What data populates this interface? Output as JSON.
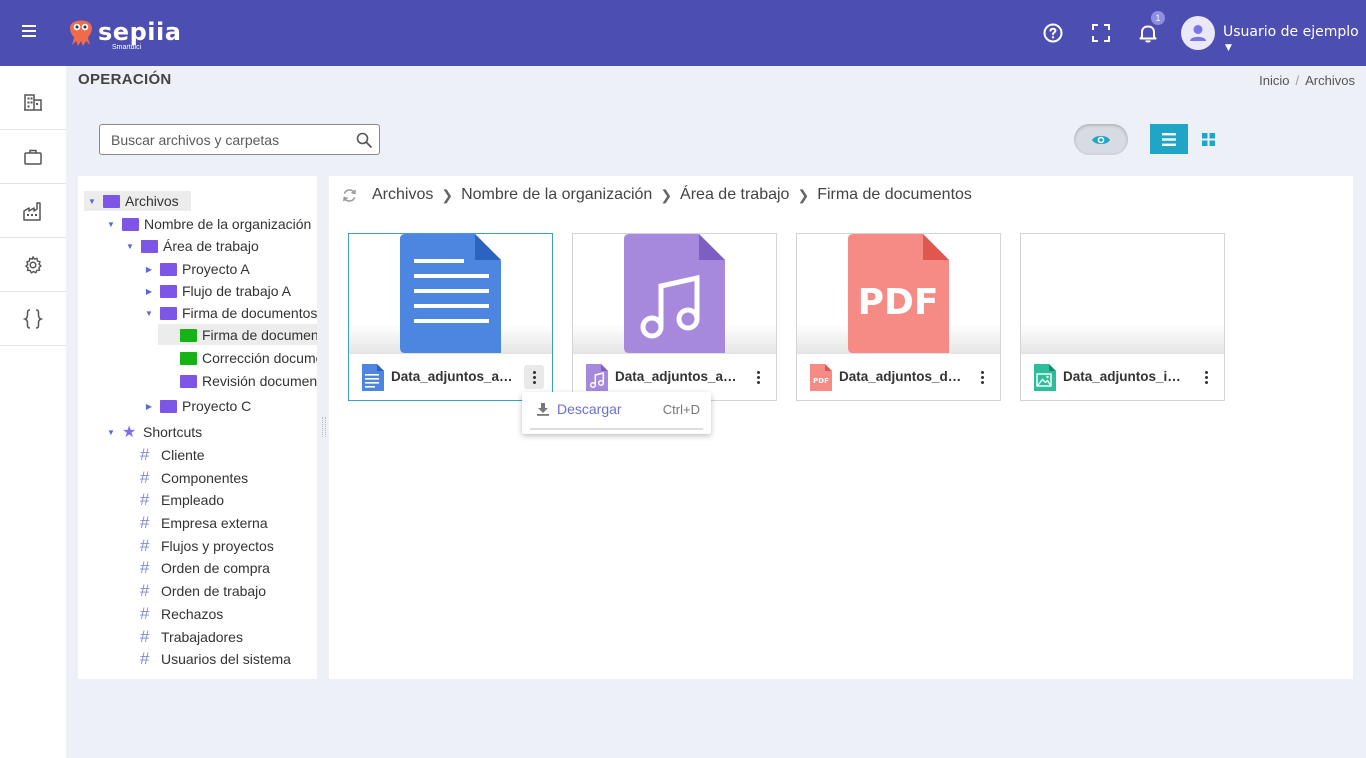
{
  "app": {
    "brand": "sepiia",
    "brand_sub": "Smartdici",
    "notifications_count": "1",
    "user_name": "Usuario de ejemplo",
    "colors": {
      "topbar": "#4d4eb1",
      "accent": "#1fa6c7",
      "folder": "#7d56e8",
      "folder_active": "#16b316"
    }
  },
  "header": {
    "title": "OPERACIÓN",
    "breadcrumb": [
      "Inicio",
      "Archivos"
    ]
  },
  "sidebar": {
    "items": [
      {
        "icon": "building-icon"
      },
      {
        "icon": "briefcase-icon"
      },
      {
        "icon": "factory-icon"
      },
      {
        "icon": "gear-icon"
      },
      {
        "icon": "braces-icon"
      }
    ]
  },
  "toolbar": {
    "search_placeholder": "Buscar archivos y carpetas",
    "view_mode": "list"
  },
  "tree": {
    "root": "Archivos",
    "org": "Nombre de la organización",
    "area": "Área de trabajo",
    "proj_a": "Proyecto A",
    "flujo_a": "Flujo de trabajo A",
    "firma": "Firma de documentos",
    "firma_child": "Firma de documentos",
    "correccion": "Corrección documentos",
    "revision": "Revisión documentos",
    "proj_c": "Proyecto C",
    "shortcuts": "Shortcuts",
    "shortcut_items": [
      "Cliente",
      "Componentes",
      "Empleado",
      "Empresa externa",
      "Flujos y proyectos",
      "Orden de compra",
      "Orden de trabajo",
      "Rechazos",
      "Trabajadores",
      "Usuarios del sistema"
    ]
  },
  "path": [
    "Archivos",
    "Nombre de la organización",
    "Área de trabajo",
    "Firma de documentos"
  ],
  "files": [
    {
      "name": "Data_adjuntos_audio_texto",
      "type": "document"
    },
    {
      "name": "Data_adjuntos_audio",
      "type": "audio"
    },
    {
      "name": "Data_adjuntos_documento",
      "type": "pdf",
      "thumb_label": "PDF",
      "icon_label": "PDF"
    },
    {
      "name": "Data_adjuntos_imagen",
      "type": "image"
    }
  ],
  "context_menu": {
    "download_label": "Descargar",
    "download_shortcut": "Ctrl+D"
  }
}
